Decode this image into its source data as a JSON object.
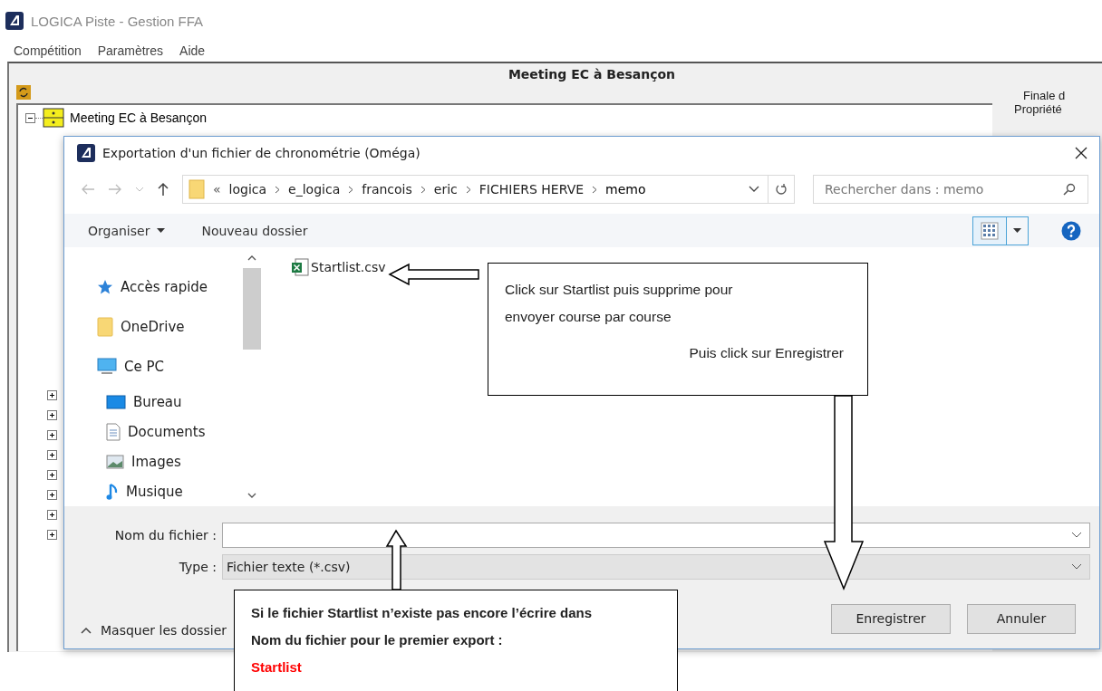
{
  "app": {
    "title": "LOGICA Piste - Gestion FFA",
    "menu": [
      "Compétition",
      "Paramètres",
      "Aide"
    ]
  },
  "meeting": {
    "title": "Meeting EC à Besançon",
    "tree": [
      {
        "label": "Meeting EC à Besançon",
        "expanded": true
      }
    ],
    "hidden_nodes": [
      {
        "expanded": false
      },
      {
        "expanded": false
      },
      {
        "expanded": false
      },
      {
        "expanded": false
      },
      {
        "expanded": false
      },
      {
        "expanded": false
      },
      {
        "expanded": false
      },
      {
        "expanded": false
      }
    ]
  },
  "side_labels": [
    "Finale d",
    "Propriété"
  ],
  "dialog": {
    "title": "Exportation d'un fichier de chronométrie (Oméga)",
    "overflow_mark": "«",
    "breadcrumb": [
      {
        "label": "logica",
        "selected": false
      },
      {
        "label": "e_logica",
        "selected": false
      },
      {
        "label": "francois",
        "selected": false
      },
      {
        "label": "eric",
        "selected": false
      },
      {
        "label": "FICHIERS HERVE",
        "selected": false
      },
      {
        "label": "memo",
        "selected": true
      }
    ],
    "search": {
      "placeholder": "Rechercher dans : memo"
    },
    "toolbar": [
      "Organiser",
      "Nouveau dossier"
    ],
    "nav": [
      {
        "label": "Accès rapide",
        "kind": "star"
      },
      {
        "label": "OneDrive",
        "kind": "folder"
      },
      {
        "label": "Ce PC",
        "kind": "pc",
        "children": [
          {
            "label": "Bureau",
            "kind": "desktop"
          },
          {
            "label": "Documents",
            "kind": "documents"
          },
          {
            "label": "Images",
            "kind": "images"
          },
          {
            "label": "Musique",
            "kind": "music"
          }
        ]
      }
    ],
    "files": [
      {
        "name": "Startlist.csv",
        "selected": false
      }
    ],
    "filename": {
      "label": "Nom du fichier :"
    },
    "type": {
      "label": "Type :",
      "value": "Fichier texte (*.csv)"
    },
    "hide_folders": "Masquer les dossier",
    "buttons": [
      "Enregistrer",
      "Annuler"
    ]
  },
  "annotations": [
    {
      "lines": [
        "Click sur Startlist puis supprime pour",
        "envoyer course par course"
      ],
      "footer": "Puis click sur Enregistrer"
    },
    {
      "text": "Si le fichier Startlist n’existe pas encore l’écrire dans Nom du fichier pour le premier export :",
      "emphasis": "Startlist"
    }
  ]
}
